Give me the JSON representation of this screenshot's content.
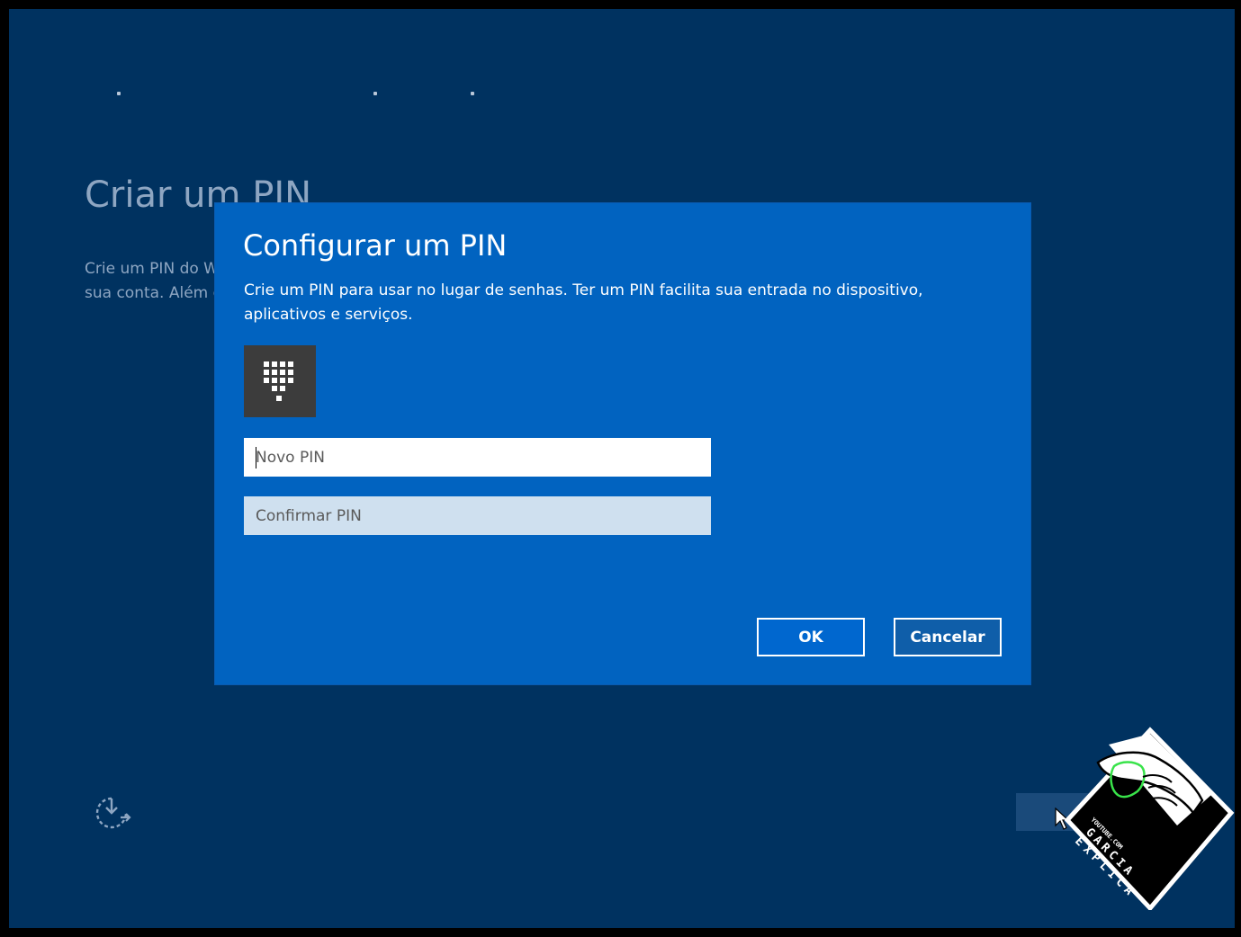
{
  "background": {
    "title": "Criar um PIN",
    "desc_lines": [
      "Crie um PIN do Windows",
      "sua conta. Além disso,"
    ]
  },
  "dialog": {
    "title": "Configurar um PIN",
    "description": "Crie um PIN para usar no lugar de senhas. Ter um PIN facilita sua entrada no dispositivo, aplicativos e serviços.",
    "new_pin_placeholder": "Novo PIN",
    "new_pin_value": "",
    "confirm_pin_placeholder": "Confirmar PIN",
    "confirm_pin_value": "",
    "ok_label": "OK",
    "cancel_label": "Cancelar"
  },
  "icons": {
    "pin_tile": "keypad-icon",
    "ease_of_access": "ease-of-access-icon",
    "cursor": "mouse-pointer-icon",
    "watermark": "garcia-explica-logo"
  },
  "watermark": {
    "line1": "YOUTUBE.COM",
    "line2": "GARCIA",
    "line3": "EXPLICA"
  },
  "colors": {
    "screen_bg": "#003260",
    "dialog_bg": "#0163c0",
    "pin_tile_bg": "#3c3c3c",
    "confirm_field_bg": "#cfe0ef",
    "text_white": "#ffffff"
  }
}
